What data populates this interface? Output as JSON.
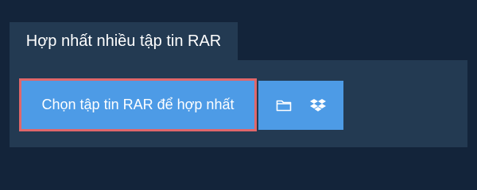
{
  "tab": {
    "label": "Hợp nhất nhiều tập tin RAR"
  },
  "upload": {
    "choose_label": "Chọn tập tin RAR để hợp nhất",
    "sources": [
      {
        "icon": "folder-icon"
      },
      {
        "icon": "dropbox-icon"
      }
    ]
  },
  "colors": {
    "background": "#13243a",
    "panel": "#233a52",
    "button": "#4d9be6",
    "highlight_border": "#e0676a",
    "text": "#ffffff"
  }
}
